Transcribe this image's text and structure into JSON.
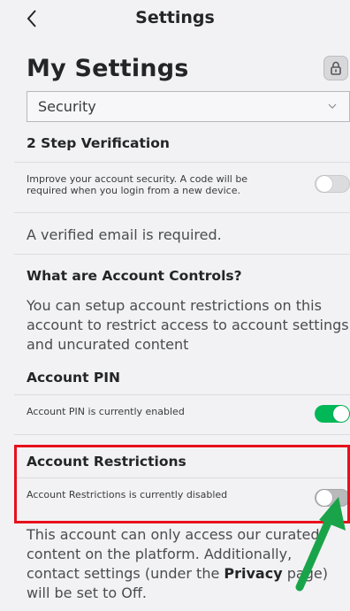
{
  "header": {
    "title": "Settings",
    "back_icon": "chevron-left-icon"
  },
  "page": {
    "title": "My Settings",
    "lock_icon": "lock-icon"
  },
  "category_select": {
    "selected": "Security",
    "chevron_icon": "chevron-down-icon"
  },
  "two_step": {
    "heading": "2 Step Verification",
    "description": "Improve your account security. A code will be required when you login from a new device.",
    "enabled": false
  },
  "verified_email_note": "A verified email is required.",
  "account_controls": {
    "heading": "What are Account Controls?",
    "description": "You can setup account restrictions on this account to restrict access to account settings and uncurated content"
  },
  "account_pin": {
    "heading": "Account PIN",
    "status": "Account PIN is currently enabled",
    "enabled": true
  },
  "account_restrictions": {
    "heading": "Account Restrictions",
    "status": "Account Restrictions is currently disabled",
    "enabled": false,
    "info_before": "This account can only access our curated content on the platform. Additionally, contact settings (under the ",
    "info_link": "Privacy",
    "info_after": " page) will be set to Off."
  },
  "colors": {
    "toggle_on": "#02b757",
    "highlight": "#e8101c",
    "arrow": "#1aa44a"
  }
}
